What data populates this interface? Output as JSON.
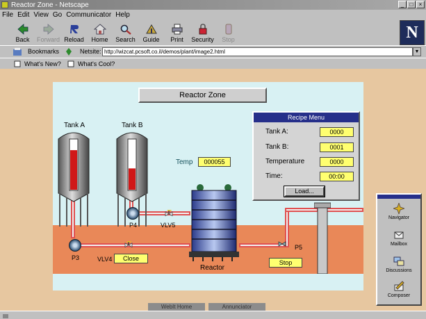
{
  "window": {
    "title": "Reactor Zone - Netscape"
  },
  "menu": [
    "File",
    "Edit",
    "View",
    "Go",
    "Communicator",
    "Help"
  ],
  "toolbar": [
    {
      "label": "Back",
      "icon": "back-arrow-icon",
      "enabled": true
    },
    {
      "label": "Forward",
      "icon": "forward-arrow-icon",
      "enabled": false
    },
    {
      "label": "Reload",
      "icon": "reload-icon",
      "enabled": true
    },
    {
      "label": "Home",
      "icon": "home-icon",
      "enabled": true
    },
    {
      "label": "Search",
      "icon": "search-icon",
      "enabled": true
    },
    {
      "label": "Guide",
      "icon": "guide-icon",
      "enabled": true
    },
    {
      "label": "Print",
      "icon": "print-icon",
      "enabled": true
    },
    {
      "label": "Security",
      "icon": "lock-icon",
      "enabled": true
    },
    {
      "label": "Stop",
      "icon": "stop-icon",
      "enabled": false
    }
  ],
  "location": {
    "bookmarks_label": "Bookmarks",
    "netsite_label": "Netsite:",
    "url": "http://wizcat.pcsoft.co.il/demos/plant/image2.html"
  },
  "personal": {
    "whats_new": "What's New?",
    "whats_cool": "What's Cool?"
  },
  "scada": {
    "zone_title": "Reactor Zone",
    "tank_a": "Tank A",
    "tank_b": "Tank B",
    "tank_a_level": 0.78,
    "tank_b_level": 0.42,
    "temp_label": "Temp",
    "temp_value": "000055",
    "recipe": {
      "title": "Recipe Menu",
      "rows": [
        {
          "label": "Tank A:",
          "value": "0000"
        },
        {
          "label": "Tank B:",
          "value": "0001"
        },
        {
          "label": "Temperature",
          "value": "0000"
        },
        {
          "label": "Time:",
          "value": "00:00"
        }
      ],
      "load_label": "Load..."
    },
    "p3": "P3",
    "p4": "P4",
    "p5": "P5",
    "vlv4": "VLV4",
    "vlv5": "VLV5",
    "close_value": "Close",
    "stop_value": "Stop",
    "reactor": "Reactor"
  },
  "component_bar": [
    "Navigator",
    "Mailbox",
    "Discussions",
    "Composer"
  ],
  "bottom_buttons": [
    "WebIt Home",
    "Annunciator"
  ],
  "colors": {
    "pipe": "#e05050",
    "scene_bg": "#d8f1f3",
    "ground": "#e98858",
    "page_bg": "#e7c7a0",
    "tag_yellow": "#ffff70",
    "recipe_header": "#262f8a"
  }
}
